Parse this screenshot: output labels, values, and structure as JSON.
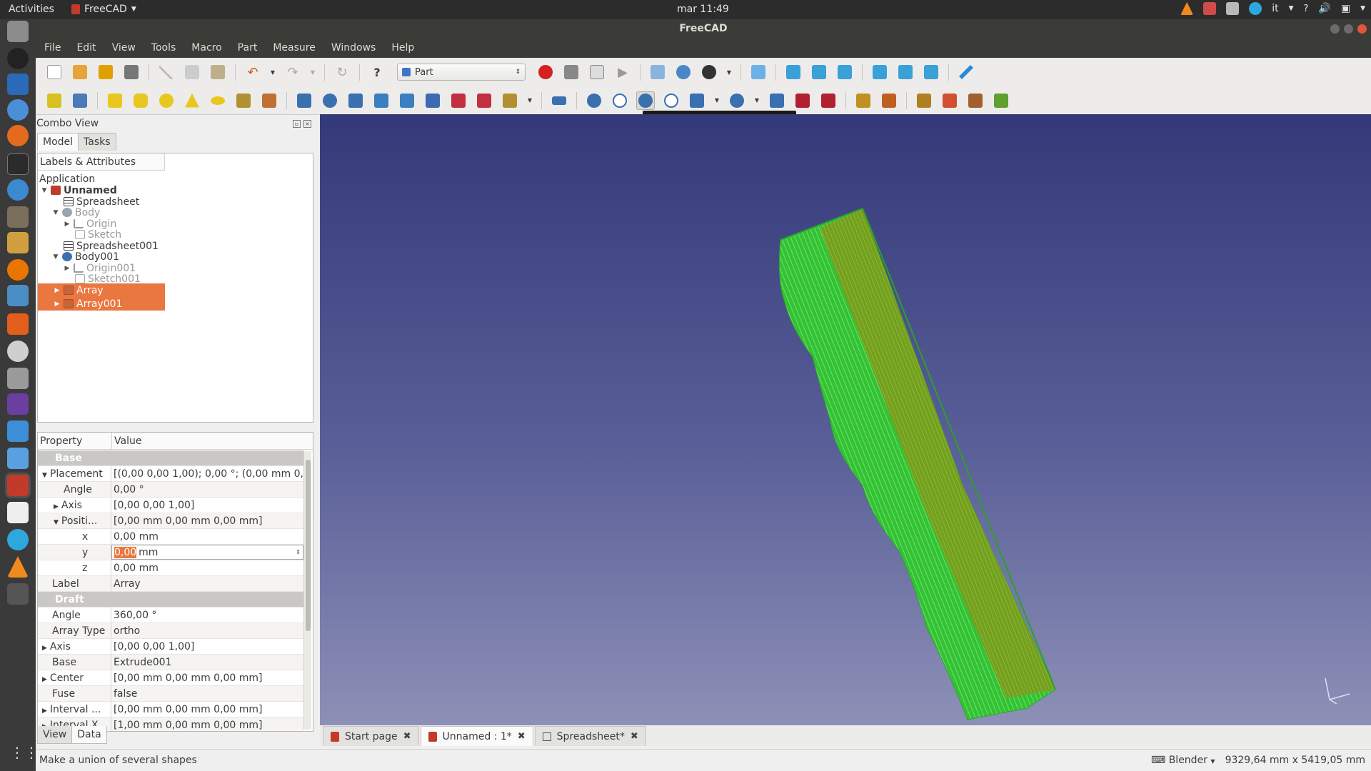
{
  "topbar": {
    "activities": "Activities",
    "app_name": "FreeCAD",
    "clock": "mar 11:49",
    "lang": "it"
  },
  "window": {
    "title": "FreeCAD"
  },
  "menu": [
    "File",
    "Edit",
    "View",
    "Tools",
    "Macro",
    "Part",
    "Measure",
    "Windows",
    "Help"
  ],
  "workbench": {
    "selected": "Part"
  },
  "tooltip": "Make a union of several shapes",
  "combo": {
    "title": "Combo View",
    "tabs": [
      "Model",
      "Tasks"
    ],
    "bottom_tabs": [
      "View",
      "Data"
    ]
  },
  "tree": {
    "header": "Labels & Attributes",
    "root_label": "Application",
    "nodes": [
      {
        "label": "Unnamed",
        "icon": "document-icon"
      },
      {
        "label": "Spreadsheet",
        "icon": "spreadsheet-icon"
      },
      {
        "label": "Body",
        "icon": "body-icon"
      },
      {
        "label": "Origin",
        "icon": "origin-icon"
      },
      {
        "label": "Sketch",
        "icon": "sketch-icon"
      },
      {
        "label": "Spreadsheet001",
        "icon": "spreadsheet-icon"
      },
      {
        "label": "Body001",
        "icon": "body-icon"
      },
      {
        "label": "Origin001",
        "icon": "origin-icon"
      },
      {
        "label": "Sketch001",
        "icon": "sketch-icon"
      },
      {
        "label": "Array",
        "icon": "array-icon"
      },
      {
        "label": "Array001",
        "icon": "array-icon"
      }
    ]
  },
  "properties": {
    "col_property": "Property",
    "col_value": "Value",
    "rows": [
      {
        "name": "Base",
        "value": ""
      },
      {
        "name": "Placement",
        "value": "[(0,00 0,00 1,00); 0,00 °; (0,00 mm  0,0..."
      },
      {
        "name": "Angle",
        "value": "0,00 °"
      },
      {
        "name": "Axis",
        "value": "[0,00 0,00 1,00]"
      },
      {
        "name": "Positi...",
        "value": "[0,00 mm  0,00 mm  0,00 mm]"
      },
      {
        "name": "x",
        "value": "0,00 mm"
      },
      {
        "name": "y",
        "value": "0,00",
        "unit": "mm"
      },
      {
        "name": "z",
        "value": "0,00 mm"
      },
      {
        "name": "Label",
        "value": "Array"
      },
      {
        "name": "Draft",
        "value": ""
      },
      {
        "name": "Angle",
        "value": "360,00 °"
      },
      {
        "name": "Array Type",
        "value": "ortho"
      },
      {
        "name": "Axis",
        "value": "[0,00 0,00 1,00]"
      },
      {
        "name": "Base",
        "value": "Extrude001"
      },
      {
        "name": "Center",
        "value": "[0,00 mm  0,00 mm  0,00 mm]"
      },
      {
        "name": "Fuse",
        "value": "false"
      },
      {
        "name": "Interval ...",
        "value": "[0,00 mm  0,00 mm  0,00 mm]"
      },
      {
        "name": "Interval X",
        "value": "[1,00 mm  0,00 mm  0,00 mm]"
      }
    ]
  },
  "doc_tabs": [
    "Start page",
    "Unnamed : 1*",
    "Spreadsheet*"
  ],
  "status": {
    "message": "Make a union of several shapes",
    "nav_style": "Blender",
    "dimensions": "9329,64 mm x 5419,05 mm"
  },
  "colors": {
    "selection": "#e9773f",
    "model_green": "#33c233",
    "model_olive": "#7a9a1e",
    "viewport_top": "#343979",
    "viewport_bottom": "#8d90b6"
  }
}
